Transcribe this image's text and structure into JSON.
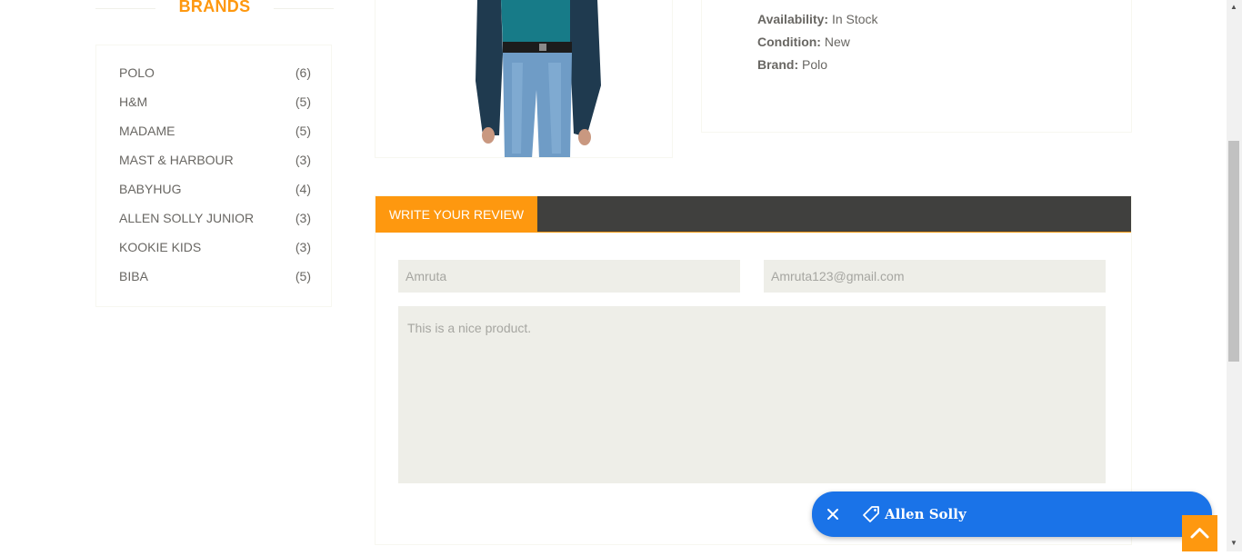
{
  "sidebar": {
    "brands_title": "BRANDS",
    "brands": [
      {
        "name": "POLO",
        "count": "(6)"
      },
      {
        "name": "H&M",
        "count": "(5)"
      },
      {
        "name": "MADAME",
        "count": "(5)"
      },
      {
        "name": "MAST & HARBOUR",
        "count": "(3)"
      },
      {
        "name": "BABYHUG",
        "count": "(4)"
      },
      {
        "name": "ALLEN SOLLY JUNIOR",
        "count": "(3)"
      },
      {
        "name": "KOOKIE KIDS",
        "count": "(3)"
      },
      {
        "name": "BIBA",
        "count": "(5)"
      }
    ]
  },
  "product": {
    "availability_label": "Availability:",
    "availability_value": "In Stock",
    "condition_label": "Condition:",
    "condition_value": "New",
    "brand_label": "Brand:",
    "brand_value": "Polo"
  },
  "review": {
    "tab_label": "WRITE YOUR REVIEW",
    "name_value": "Amruta",
    "email_value": "Amruta123@gmail.com",
    "review_value": "This is a nice product."
  },
  "tag_bar": {
    "label": "Allen Solly",
    "icon": "tag-icon",
    "close_icon": "close-icon"
  },
  "colors": {
    "accent": "#fe980f",
    "tab_bar": "#40403e",
    "field_bg": "#eeeee8",
    "tag_blue": "#1a73e8"
  }
}
